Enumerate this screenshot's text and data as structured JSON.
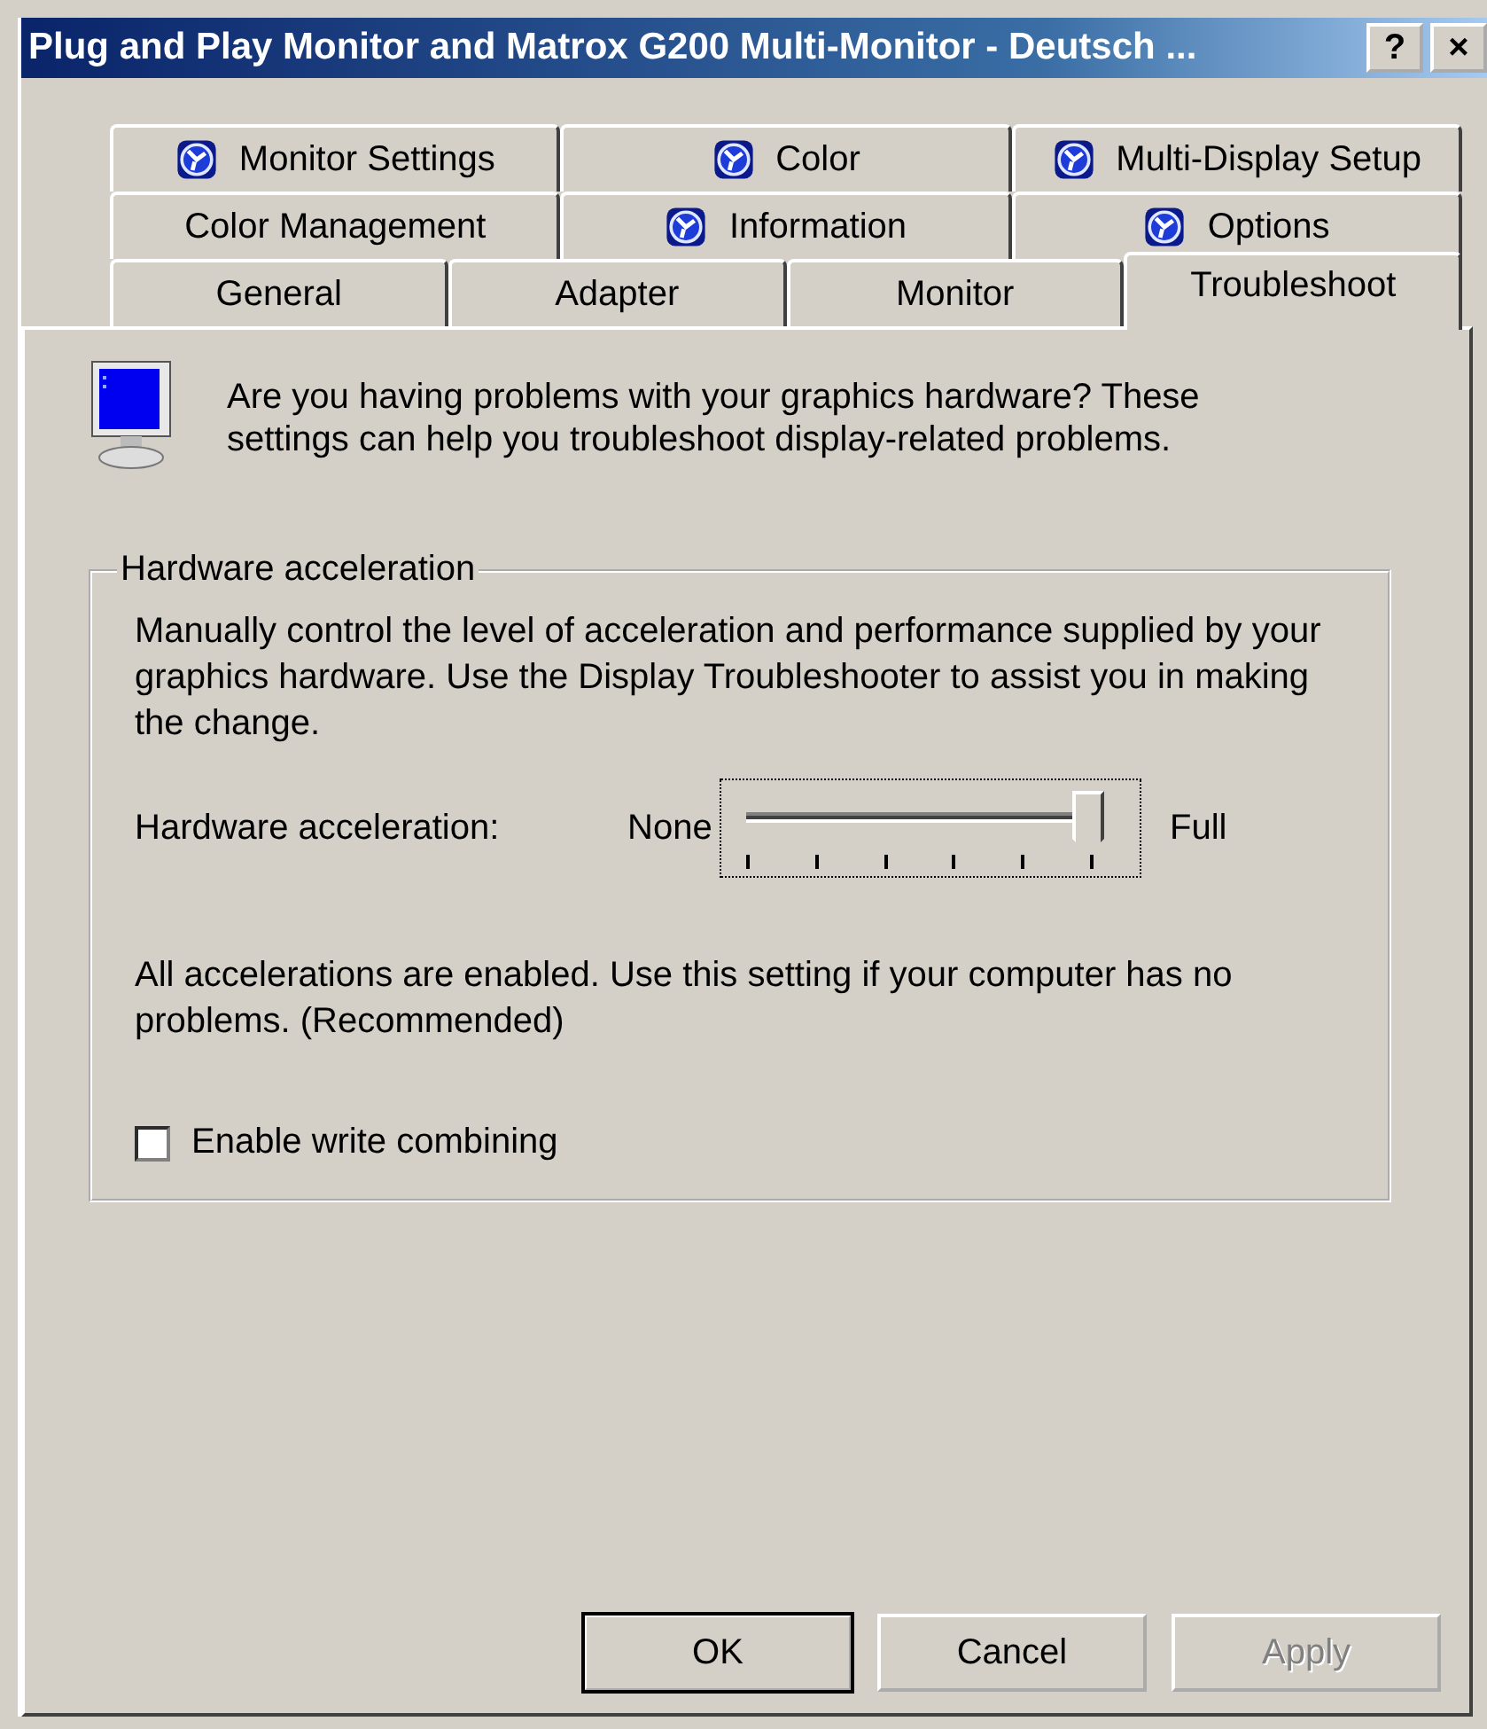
{
  "window": {
    "title": "Plug and Play Monitor and Matrox G200 Multi-Monitor - Deutsch ...",
    "title_buttons": [
      "?",
      "×"
    ]
  },
  "tab_rows": [
    {
      "tabs": [
        {
          "label": "Monitor Settings",
          "icon": true,
          "selected": false
        },
        {
          "label": "Color",
          "icon": true,
          "selected": false
        },
        {
          "label": "Multi-Display Setup",
          "icon": true,
          "selected": false
        }
      ]
    },
    {
      "tabs": [
        {
          "label": "Color Management",
          "icon": false,
          "selected": false
        },
        {
          "label": "Information",
          "icon": true,
          "selected": false
        },
        {
          "label": "Options",
          "icon": true,
          "selected": false
        }
      ]
    },
    {
      "tabs": [
        {
          "label": "General",
          "icon": false,
          "selected": false
        },
        {
          "label": "Adapter",
          "icon": false,
          "selected": false
        },
        {
          "label": "Monitor",
          "icon": false,
          "selected": false
        },
        {
          "label": "Troubleshoot",
          "icon": false,
          "selected": true
        }
      ]
    }
  ],
  "intro": "Are you having problems with your graphics hardware? These settings can help you troubleshoot display-related problems.",
  "group": {
    "title": "Hardware acceleration",
    "description": "Manually control the level of acceleration and performance supplied by your graphics hardware. Use the Display Troubleshooter to assist you in making the change.",
    "slider": {
      "label": "Hardware acceleration:",
      "min_label": "None",
      "max_label": "Full",
      "level": 1.0
    },
    "status": "All accelerations are enabled. Use this setting if your computer has no problems. (Recommended)",
    "checkbox": {
      "label": "Enable write combining",
      "checked": false
    }
  },
  "buttons": [
    {
      "label": "OK",
      "default": true,
      "disabled": false
    },
    {
      "label": "Cancel",
      "default": false,
      "disabled": false
    },
    {
      "label": "Apply",
      "default": false,
      "disabled": true
    }
  ]
}
